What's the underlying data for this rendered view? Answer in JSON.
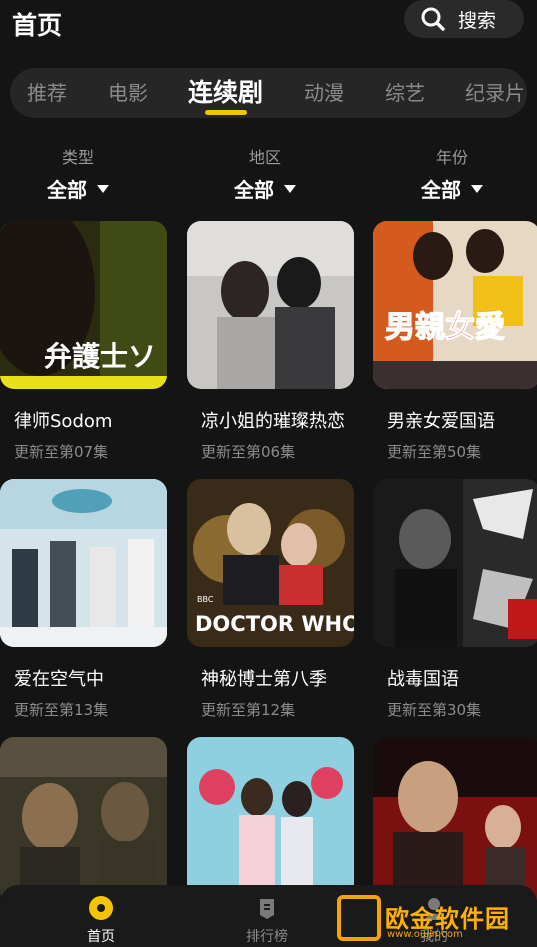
{
  "header": {
    "title": "首页",
    "search_label": "搜索"
  },
  "tabs": [
    {
      "label": "推荐"
    },
    {
      "label": "电影"
    },
    {
      "label": "连续剧",
      "active": true
    },
    {
      "label": "动漫"
    },
    {
      "label": "综艺"
    },
    {
      "label": "纪录片"
    }
  ],
  "filters": [
    {
      "label": "类型",
      "value": "全部"
    },
    {
      "label": "地区",
      "value": "全部"
    },
    {
      "label": "年份",
      "value": "全部"
    }
  ],
  "cards": [
    {
      "title": "律师Sodom",
      "subtitle": "更新至第07集",
      "poster_text": "弁護士ソ"
    },
    {
      "title": "凉小姐的璀璨热恋",
      "subtitle": "更新至第06集",
      "poster_text": ""
    },
    {
      "title": "男亲女爱国语",
      "subtitle": "更新至第50集",
      "poster_text": "男親女愛"
    },
    {
      "title": "爱在空气中",
      "subtitle": "更新至第13集",
      "poster_text": ""
    },
    {
      "title": "神秘博士第八季",
      "subtitle": "更新至第12集",
      "poster_text": "DOCTOR WHO"
    },
    {
      "title": "战毒国语",
      "subtitle": "更新至第30集",
      "poster_text": ""
    },
    {
      "title": "",
      "subtitle": "",
      "poster_text": ""
    },
    {
      "title": "",
      "subtitle": "",
      "poster_text": ""
    },
    {
      "title": "",
      "subtitle": "",
      "poster_text": ""
    }
  ],
  "bottom_nav": [
    {
      "label": "首页",
      "active": true
    },
    {
      "label": "排行榜"
    },
    {
      "label": "我的"
    }
  ],
  "watermark": {
    "text": "欧金软件园",
    "url": "www.oujin.com"
  },
  "colors": {
    "accent": "#f5c400",
    "background": "#141414",
    "inactive": "#8a8a8a"
  }
}
